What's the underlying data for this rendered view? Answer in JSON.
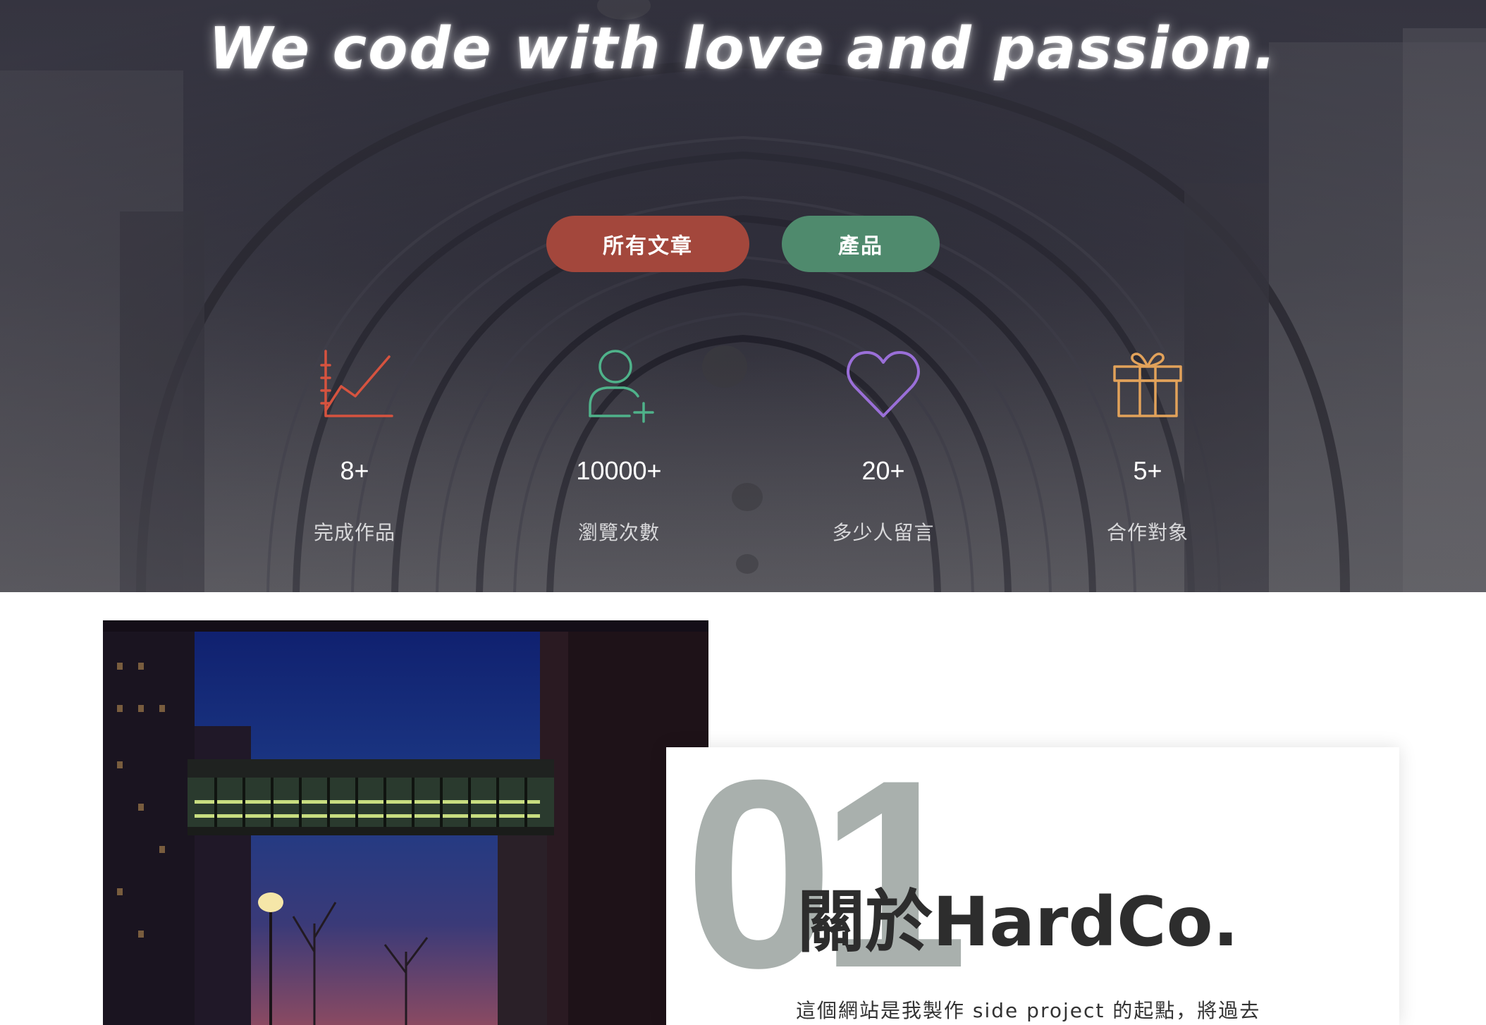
{
  "hero": {
    "title": "We code with love and passion.",
    "buttons": {
      "articles_label": "所有文章",
      "products_label": "產品"
    },
    "stats": [
      {
        "icon": "line-chart-icon",
        "value": "8+",
        "label": "完成作品",
        "color": "#d6533f"
      },
      {
        "icon": "add-user-icon",
        "value": "10000+",
        "label": "瀏覽次數",
        "color": "#4fb28a"
      },
      {
        "icon": "heart-icon",
        "value": "20+",
        "label": "多少人留言",
        "color": "#9a6fd8"
      },
      {
        "icon": "gift-icon",
        "value": "5+",
        "label": "合作對象",
        "color": "#e2a25a"
      }
    ]
  },
  "about": {
    "number": "01",
    "title": "關於HardCo.",
    "text": "這個網站是我製作 side project 的起點，將過去"
  },
  "colors": {
    "articles_button": "#a3473c",
    "products_button": "#4f8a6d",
    "number": "#a9b0ad"
  }
}
